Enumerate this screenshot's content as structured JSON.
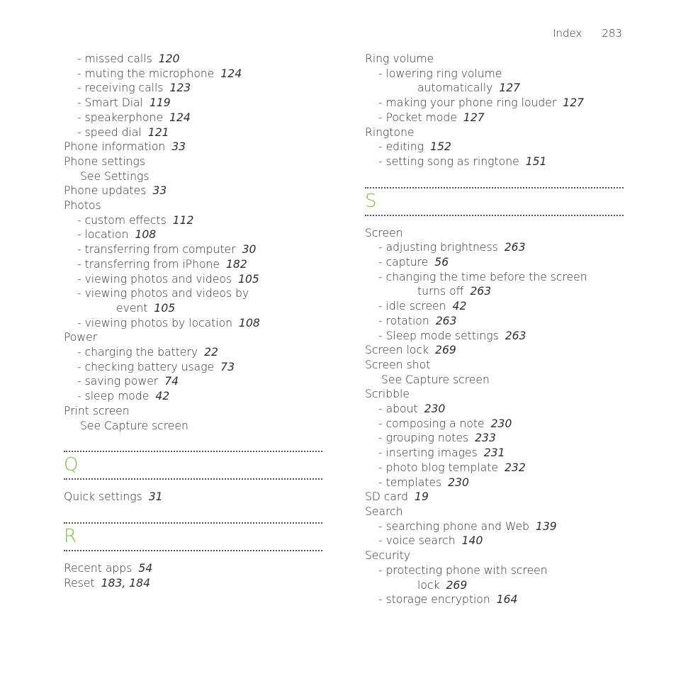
{
  "header": {
    "section": "Index",
    "page_number": "283"
  },
  "accent_color": "#78c13d",
  "left_column": [
    {
      "type": "entry",
      "level": 1,
      "text": "- missed calls",
      "pages": "120"
    },
    {
      "type": "entry",
      "level": 1,
      "text": "- muting the microphone",
      "pages": "124"
    },
    {
      "type": "entry",
      "level": 1,
      "text": "- receiving calls",
      "pages": "123"
    },
    {
      "type": "entry",
      "level": 1,
      "text": "- Smart Dial",
      "pages": "119"
    },
    {
      "type": "entry",
      "level": 1,
      "text": "- speakerphone",
      "pages": "124"
    },
    {
      "type": "entry",
      "level": 1,
      "text": "- speed dial",
      "pages": "121"
    },
    {
      "type": "entry",
      "level": 0,
      "text": "Phone information",
      "pages": "33"
    },
    {
      "type": "entry",
      "level": 0,
      "text": "Phone settings",
      "pages": ""
    },
    {
      "type": "see",
      "text": "See Settings"
    },
    {
      "type": "entry",
      "level": 0,
      "text": "Phone updates",
      "pages": "33"
    },
    {
      "type": "entry",
      "level": 0,
      "text": "Photos",
      "pages": ""
    },
    {
      "type": "entry",
      "level": 1,
      "text": "- custom effects",
      "pages": "112"
    },
    {
      "type": "entry",
      "level": 1,
      "text": "- location",
      "pages": "108"
    },
    {
      "type": "entry",
      "level": 1,
      "text": "- transferring from computer",
      "pages": "30"
    },
    {
      "type": "entry",
      "level": 1,
      "text": "- transferring from iPhone",
      "pages": "182"
    },
    {
      "type": "entry",
      "level": 1,
      "text": "- viewing photos and videos",
      "pages": "105"
    },
    {
      "type": "entry",
      "level": 1,
      "text": "- viewing photos and videos by",
      "pages": ""
    },
    {
      "type": "wrap",
      "text": "event",
      "pages": "105"
    },
    {
      "type": "entry",
      "level": 1,
      "text": "- viewing photos by location",
      "pages": "108"
    },
    {
      "type": "entry",
      "level": 0,
      "text": "Power",
      "pages": ""
    },
    {
      "type": "entry",
      "level": 1,
      "text": "- charging the battery",
      "pages": "22"
    },
    {
      "type": "entry",
      "level": 1,
      "text": "- checking battery usage",
      "pages": "73"
    },
    {
      "type": "entry",
      "level": 1,
      "text": "- saving power",
      "pages": "74"
    },
    {
      "type": "entry",
      "level": 1,
      "text": "- sleep mode",
      "pages": "42"
    },
    {
      "type": "entry",
      "level": 0,
      "text": "Print screen",
      "pages": ""
    },
    {
      "type": "see",
      "text": "See Capture screen"
    },
    {
      "type": "section",
      "letter": "Q"
    },
    {
      "type": "entry",
      "level": 0,
      "text": "Quick settings",
      "pages": "31"
    },
    {
      "type": "section",
      "letter": "R"
    },
    {
      "type": "entry",
      "level": 0,
      "text": "Recent apps",
      "pages": "54"
    },
    {
      "type": "entry",
      "level": 0,
      "text": "Reset",
      "pages": "183, 184"
    }
  ],
  "right_column": [
    {
      "type": "entry",
      "level": 0,
      "text": "Ring volume",
      "pages": ""
    },
    {
      "type": "entry",
      "level": 1,
      "text": "- lowering ring volume",
      "pages": ""
    },
    {
      "type": "wrap",
      "text": "automatically",
      "pages": "127"
    },
    {
      "type": "entry",
      "level": 1,
      "text": "- making your phone ring louder",
      "pages": "127"
    },
    {
      "type": "entry",
      "level": 1,
      "text": "- Pocket mode",
      "pages": "127"
    },
    {
      "type": "entry",
      "level": 0,
      "text": "Ringtone",
      "pages": ""
    },
    {
      "type": "entry",
      "level": 1,
      "text": "- editing",
      "pages": "152"
    },
    {
      "type": "entry",
      "level": 1,
      "text": "- setting song as ringtone",
      "pages": "151"
    },
    {
      "type": "section",
      "letter": "S"
    },
    {
      "type": "entry",
      "level": 0,
      "text": "Screen",
      "pages": ""
    },
    {
      "type": "entry",
      "level": 1,
      "text": "- adjusting brightness",
      "pages": "263"
    },
    {
      "type": "entry",
      "level": 1,
      "text": "- capture",
      "pages": "56"
    },
    {
      "type": "entry",
      "level": 1,
      "text": "- changing the time before the screen",
      "pages": ""
    },
    {
      "type": "wrap",
      "text": "turns off",
      "pages": "263"
    },
    {
      "type": "entry",
      "level": 1,
      "text": "- idle screen",
      "pages": "42"
    },
    {
      "type": "entry",
      "level": 1,
      "text": "- rotation",
      "pages": "263"
    },
    {
      "type": "entry",
      "level": 1,
      "text": "- Sleep mode settings",
      "pages": "263"
    },
    {
      "type": "entry",
      "level": 0,
      "text": "Screen lock",
      "pages": "269"
    },
    {
      "type": "entry",
      "level": 0,
      "text": "Screen shot",
      "pages": ""
    },
    {
      "type": "see",
      "text": "See Capture screen"
    },
    {
      "type": "entry",
      "level": 0,
      "text": "Scribble",
      "pages": ""
    },
    {
      "type": "entry",
      "level": 1,
      "text": "- about",
      "pages": "230"
    },
    {
      "type": "entry",
      "level": 1,
      "text": "- composing a note",
      "pages": "230"
    },
    {
      "type": "entry",
      "level": 1,
      "text": "- grouping notes",
      "pages": "233"
    },
    {
      "type": "entry",
      "level": 1,
      "text": "- inserting images",
      "pages": "231"
    },
    {
      "type": "entry",
      "level": 1,
      "text": "- photo blog template",
      "pages": "232"
    },
    {
      "type": "entry",
      "level": 1,
      "text": "- templates",
      "pages": "230"
    },
    {
      "type": "entry",
      "level": 0,
      "text": "SD card",
      "pages": "19"
    },
    {
      "type": "entry",
      "level": 0,
      "text": "Search",
      "pages": ""
    },
    {
      "type": "entry",
      "level": 1,
      "text": "- searching phone and Web",
      "pages": "139"
    },
    {
      "type": "entry",
      "level": 1,
      "text": "- voice search",
      "pages": "140"
    },
    {
      "type": "entry",
      "level": 0,
      "text": "Security",
      "pages": ""
    },
    {
      "type": "entry",
      "level": 1,
      "text": "- protecting phone with screen",
      "pages": ""
    },
    {
      "type": "wrap",
      "text": "lock",
      "pages": "269"
    },
    {
      "type": "entry",
      "level": 1,
      "text": "- storage encryption",
      "pages": "164"
    }
  ]
}
